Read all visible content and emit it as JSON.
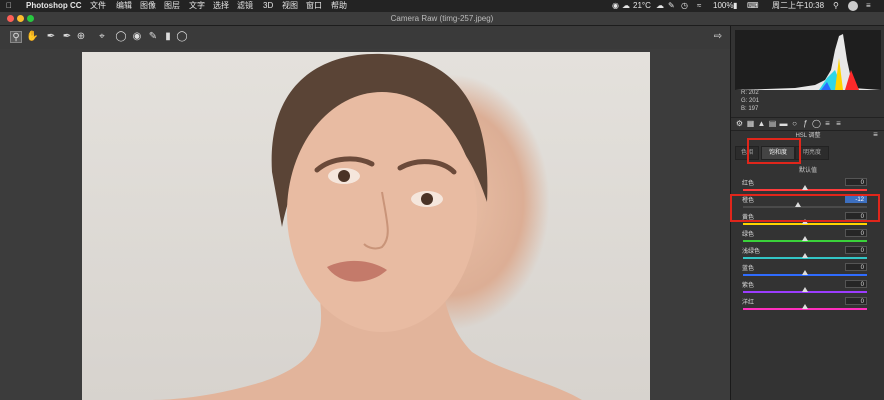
{
  "menubar": {
    "apple": "",
    "app_name": "Photoshop CC",
    "menus": [
      "文件",
      "编辑",
      "图像",
      "图层",
      "文字",
      "选择",
      "滤镜",
      "3D",
      "视图",
      "窗口",
      "帮助"
    ],
    "status": {
      "temp": "21°C",
      "battery": "100%",
      "datetime": "周二上午10:38"
    }
  },
  "window": {
    "title": "Camera Raw (timg-257.jpeg)"
  },
  "toolbar": {
    "tools": [
      "zoom-tool",
      "hand-tool",
      "white-balance-tool",
      "color-sampler-tool",
      "crop-tool",
      "straighten-tool",
      "spot-removal-tool",
      "red-eye-tool",
      "adjustment-brush-tool",
      "graduated-filter-tool",
      "radial-filter-tool"
    ],
    "open_preferences": "open-in-photoshop"
  },
  "histogram": {
    "r_label": "R:",
    "r_value": "202",
    "g_label": "G:",
    "g_value": "201",
    "b_label": "B:",
    "b_value": "197"
  },
  "panel": {
    "section_title": "HSL 调整",
    "tabs": [
      "色相",
      "饱和度",
      "明亮度"
    ],
    "active_tab": "饱和度",
    "default_link": "默认值",
    "rows": [
      {
        "label": "红色",
        "value": "0",
        "track_color": "#ff3c3c",
        "level": 0
      },
      {
        "label": "橙色",
        "value": "-12",
        "track_color": "#4a4a4a",
        "level": -12
      },
      {
        "label": "黄色",
        "value": "0",
        "track_color": "#ffd400",
        "level": 0
      },
      {
        "label": "绿色",
        "value": "0",
        "track_color": "#3ad23a",
        "level": 0
      },
      {
        "label": "浅绿色",
        "value": "0",
        "track_color": "#33c6c6",
        "level": 0
      },
      {
        "label": "蓝色",
        "value": "0",
        "track_color": "#2f6cff",
        "level": 0
      },
      {
        "label": "紫色",
        "value": "0",
        "track_color": "#9b3cff",
        "level": 0
      },
      {
        "label": "洋红",
        "value": "0",
        "track_color": "#ff2fbd",
        "level": 0
      }
    ]
  },
  "colors": {
    "highlight": "#e0261b",
    "selected_value": "#3d6fbf"
  }
}
